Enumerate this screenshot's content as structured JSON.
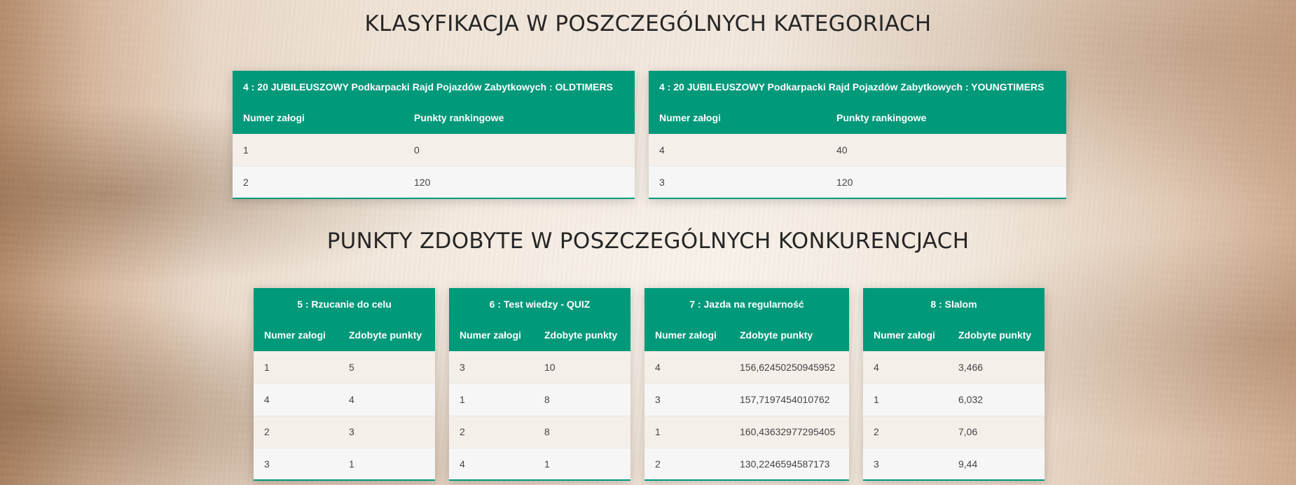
{
  "headings": {
    "category_classification": "KLASYFIKACJA W POSZCZEGÓLNYCH KATEGORIACH",
    "competition_points": "PUNKTY ZDOBYTE W POSZCZEGÓLNYCH KONKURENCJACH"
  },
  "category_tables": [
    {
      "caption": "4 : 20 JUBILEUSZOWY Podkarpacki Rajd Pojazdów Zabytkowych : OLDTIMERS",
      "columns": [
        "Numer załogi",
        "Punkty rankingowe"
      ],
      "rows": [
        [
          "1",
          "0"
        ],
        [
          "2",
          "120"
        ]
      ]
    },
    {
      "caption": "4 : 20 JUBILEUSZOWY Podkarpacki Rajd Pojazdów Zabytkowych : YOUNGTIMERS",
      "columns": [
        "Numer załogi",
        "Punkty rankingowe"
      ],
      "rows": [
        [
          "4",
          "40"
        ],
        [
          "3",
          "120"
        ]
      ]
    }
  ],
  "competition_tables": [
    {
      "caption": "5 : Rzucanie do celu",
      "columns": [
        "Numer załogi",
        "Zdobyte punkty"
      ],
      "rows": [
        [
          "1",
          "5"
        ],
        [
          "4",
          "4"
        ],
        [
          "2",
          "3"
        ],
        [
          "3",
          "1"
        ]
      ]
    },
    {
      "caption": "6 : Test wiedzy - QUIZ",
      "columns": [
        "Numer załogi",
        "Zdobyte punkty"
      ],
      "rows": [
        [
          "3",
          "10"
        ],
        [
          "1",
          "8"
        ],
        [
          "2",
          "8"
        ],
        [
          "4",
          "1"
        ]
      ]
    },
    {
      "caption": "7 : Jazda na regularność",
      "columns": [
        "Numer załogi",
        "Zdobyte punkty"
      ],
      "rows": [
        [
          "4",
          "156,62450250945952"
        ],
        [
          "3",
          "157,7197454010762"
        ],
        [
          "1",
          "160,43632977295405"
        ],
        [
          "2",
          "130,2246594587173"
        ]
      ]
    },
    {
      "caption": "8 : Slalom",
      "columns": [
        "Numer załogi",
        "Zdobyte punkty"
      ],
      "rows": [
        [
          "4",
          "3,466"
        ],
        [
          "1",
          "6,032"
        ],
        [
          "2",
          "7,06"
        ],
        [
          "3",
          "9,44"
        ]
      ]
    }
  ],
  "colors": {
    "header_green": "#00997a",
    "title_text": "#262626"
  }
}
